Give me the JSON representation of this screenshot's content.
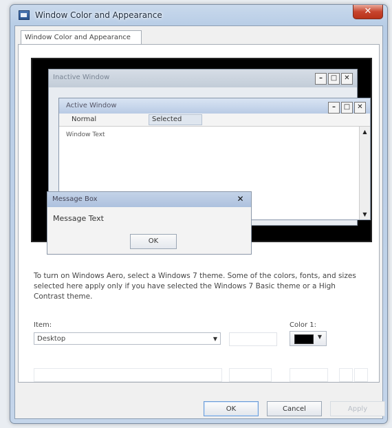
{
  "window": {
    "title": "Window Color and Appearance",
    "close_glyph": "✕"
  },
  "tab": {
    "label": "Window Color and Appearance"
  },
  "preview": {
    "inactive_window_title": "Inactive Window",
    "active_window_title": "Active Window",
    "menu_normal": "Normal",
    "menu_selected": "Selected",
    "window_text": "Window Text",
    "min_glyph": "–",
    "max_glyph": "□",
    "close_glyph": "✕",
    "scroll_up": "▲",
    "scroll_down": "▼",
    "message_box_title": "Message Box",
    "message_text": "Message Text",
    "message_ok": "OK"
  },
  "description": "To turn on Windows Aero, select a Windows 7 theme. Some of the colors, fonts, and sizes selected here apply only if you have selected the Windows 7 Basic theme or a High Contrast theme.",
  "item": {
    "label": "Item:",
    "value": "Desktop",
    "arrow": "▼"
  },
  "color1": {
    "label": "Color 1:",
    "value_color": "#000000",
    "arrow": "▼"
  },
  "buttons": {
    "ok": "OK",
    "cancel": "Cancel",
    "apply": "Apply"
  },
  "accent": {
    "selection": "#cfe3fa",
    "titlebar": "#b8cde6"
  }
}
